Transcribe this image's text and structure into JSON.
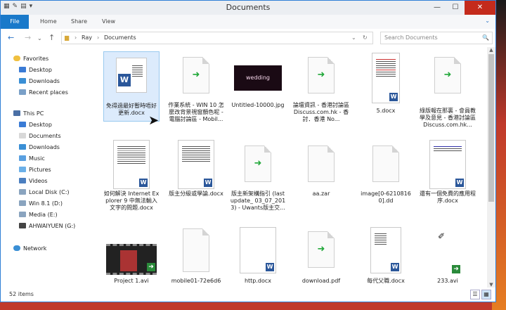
{
  "window": {
    "title": "Documents",
    "minimize": "—",
    "maximize": "☐",
    "close": "✕"
  },
  "ribbon": {
    "tabs": [
      "File",
      "Home",
      "Share",
      "View"
    ],
    "expand": "⌄"
  },
  "address": {
    "path": [
      "Ray",
      "Documents"
    ],
    "search_placeholder": "Search Documents"
  },
  "nav": {
    "favorites": "Favorites",
    "fav_items": [
      "Desktop",
      "Downloads",
      "Recent places"
    ],
    "thispc": "This PC",
    "pc_items": [
      "Desktop",
      "Documents",
      "Downloads",
      "Music",
      "Pictures",
      "Videos",
      "Local Disk (C:)",
      "Win 8.1 (D:)",
      "Media (E:)",
      "AHWAIYUEN (G:)"
    ],
    "network": "Network"
  },
  "items": [
    {
      "name": "免得過最好暫時唔好更新.docx",
      "type": "word-big"
    },
    {
      "name": "作業系統 - WIN 10 怎麼改背景視窗顏色呢 - 電腦討論區 - Mobil...",
      "type": "link"
    },
    {
      "name": "Untitled-10000.jpg",
      "type": "image",
      "label": "wedding"
    },
    {
      "name": "論壇資訊 - 香港討論區 Discuss.com.hk - 香討．香港 No...",
      "type": "link"
    },
    {
      "name": "5.docx",
      "type": "word"
    },
    {
      "name": "綠版報在那裏 - 會員教學及意見 - 香港討論區 Discuss.com.hk...",
      "type": "link"
    },
    {
      "name": "如何解決 Internet Explorer 9 中無法輸入文字的問題.docx",
      "type": "word"
    },
    {
      "name": "版主分級或學論.docx",
      "type": "word"
    },
    {
      "name": "版主新架構指引 (last update_ 03_07_2013) - Uwants版主交...",
      "type": "link"
    },
    {
      "name": "aa.zar",
      "type": "blank"
    },
    {
      "name": "image[0-62108160].dd",
      "type": "blank"
    },
    {
      "name": "還有一個免費的應用程序.docx",
      "type": "word"
    },
    {
      "name": "Project 1.avi",
      "type": "video"
    },
    {
      "name": "mobile01-72e6d6",
      "type": "blank"
    },
    {
      "name": "http.docx",
      "type": "word"
    },
    {
      "name": "download.pdf",
      "type": "link"
    },
    {
      "name": "每代父職.docx",
      "type": "word"
    },
    {
      "name": "233.avi",
      "type": "video-sketch"
    }
  ],
  "status": {
    "count": "52 items"
  },
  "icons": {
    "word_badge": "W",
    "arrow": "➜",
    "search": "🔍"
  },
  "colors": {
    "accent": "#1979ca",
    "selection": "#dcebfc",
    "close": "#c42b1c"
  }
}
